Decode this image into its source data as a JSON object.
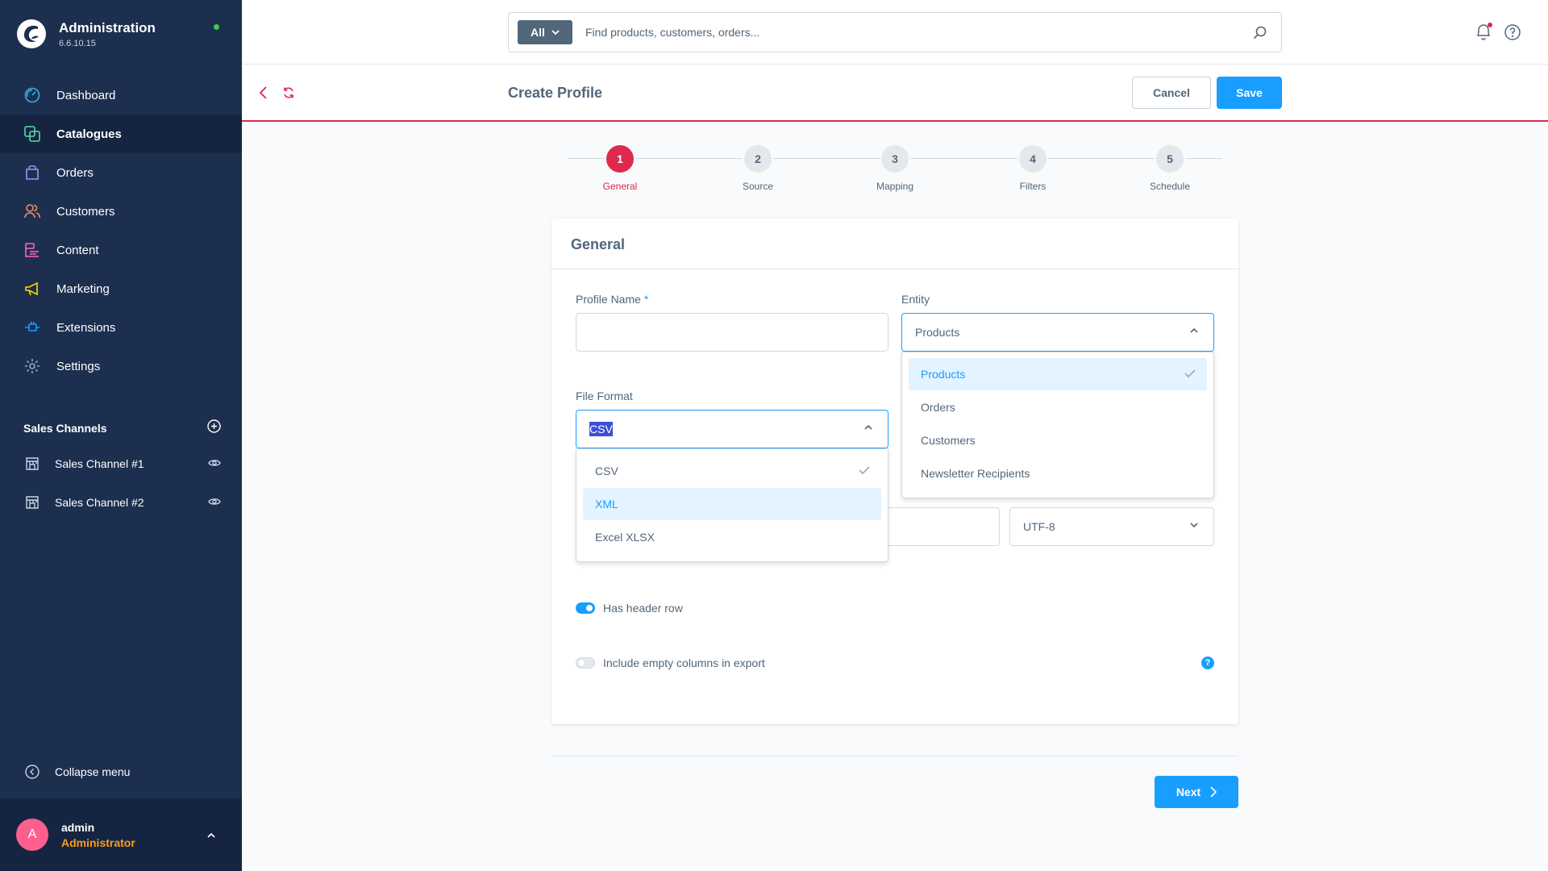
{
  "brand": {
    "title": "Administration",
    "version": "6.6.10.15"
  },
  "nav": {
    "items": [
      {
        "label": "Dashboard",
        "icon": "gauge-icon"
      },
      {
        "label": "Catalogues",
        "icon": "catalogue-icon"
      },
      {
        "label": "Orders",
        "icon": "shopping-bag-icon"
      },
      {
        "label": "Customers",
        "icon": "users-icon"
      },
      {
        "label": "Content",
        "icon": "content-icon"
      },
      {
        "label": "Marketing",
        "icon": "megaphone-icon"
      },
      {
        "label": "Extensions",
        "icon": "plug-icon"
      },
      {
        "label": "Settings",
        "icon": "gear-icon"
      }
    ]
  },
  "sales_channels": {
    "title": "Sales Channels",
    "items": [
      {
        "label": "Sales Channel #1"
      },
      {
        "label": "Sales Channel #2"
      }
    ]
  },
  "collapse_label": "Collapse menu",
  "user": {
    "initial": "A",
    "name": "admin",
    "role": "Administrator"
  },
  "search": {
    "scope": "All",
    "placeholder": "Find products, customers, orders..."
  },
  "smartbar": {
    "title": "Create Profile",
    "cancel": "Cancel",
    "save": "Save"
  },
  "steps": [
    {
      "number": "1",
      "label": "General"
    },
    {
      "number": "2",
      "label": "Source"
    },
    {
      "number": "3",
      "label": "Mapping"
    },
    {
      "number": "4",
      "label": "Filters"
    },
    {
      "number": "5",
      "label": "Schedule"
    }
  ],
  "form": {
    "card_title": "General",
    "profile_name_label": "Profile Name",
    "required_mark": "*",
    "profile_name_value": "",
    "entity_label": "Entity",
    "entity_value": "Products",
    "entity_options": [
      "Products",
      "Orders",
      "Customers",
      "Newsletter Recipients"
    ],
    "file_format_label": "File Format",
    "file_format_value": "CSV",
    "file_format_options": [
      "CSV",
      "XML",
      "Excel XLSX"
    ],
    "encoding_value": "UTF-8",
    "has_header_label": "Has header row",
    "has_header_on": true,
    "include_empty_label": "Include empty columns in export",
    "include_empty_on": false,
    "help_badge": "?"
  },
  "next_label": "Next",
  "colors": {
    "sidebar": "#1d2f4f",
    "accent": "#189eff",
    "active_step": "#de294c",
    "user_role": "#ff9b1a"
  }
}
